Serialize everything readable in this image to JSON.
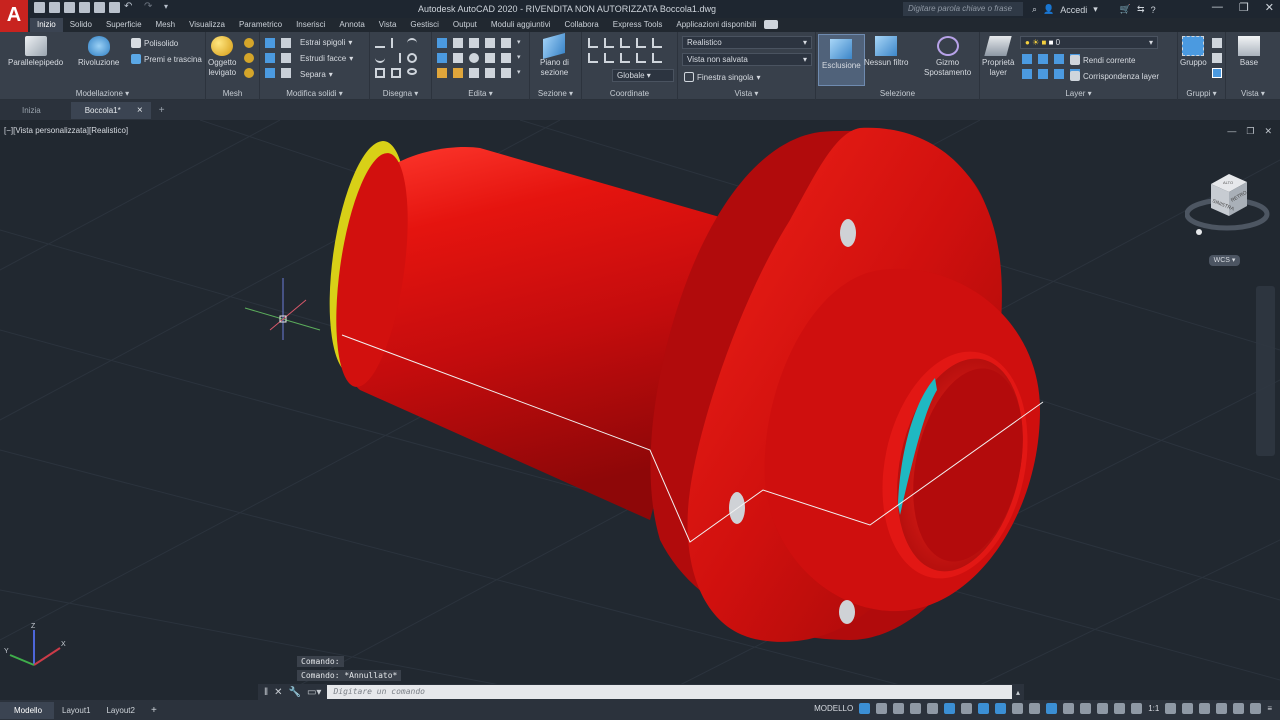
{
  "titlebar": {
    "app_title": "Autodesk AutoCAD 2020 - RIVENDITA NON AUTORIZZATA    Boccola1.dwg",
    "search_placeholder": "Digitare parola chiave o frase",
    "signin_label": "Accedi",
    "logo_letter": "A"
  },
  "ribbon_tabs": [
    "Inizio",
    "Solido",
    "Superficie",
    "Mesh",
    "Visualizza",
    "Parametrico",
    "Inserisci",
    "Annota",
    "Vista",
    "Gestisci",
    "Output",
    "Moduli aggiuntivi",
    "Collabora",
    "Express Tools",
    "Applicazioni disponibili"
  ],
  "ribbon": {
    "modellazione": {
      "title": "Modellazione",
      "parallelepipedo": "Parallelepipedo",
      "rivoluzione": "Rivoluzione",
      "polisolido": "Polisolido",
      "premi": "Premi e trascina"
    },
    "mesh": {
      "title": "Mesh",
      "oggetto": "Oggetto",
      "levigato": "levigato"
    },
    "modifica": {
      "title": "Modifica solidi",
      "estrai": "Estrai spigoli",
      "estrudi": "Estrudi facce",
      "separa": "Separa"
    },
    "disegna": {
      "title": "Disegna"
    },
    "edita": {
      "title": "Edita"
    },
    "sezione": {
      "title": "Sezione",
      "piano": "Piano di",
      "sezione_lbl": "sezione"
    },
    "coordinate": {
      "title": "Coordinate",
      "globale": "Globale"
    },
    "vista": {
      "title": "Vista",
      "style": "Realistico",
      "saved": "Vista non salvata",
      "finestra": "Finestra singola"
    },
    "selezione": {
      "title": "Selezione",
      "esclusione": "Esclusione",
      "nessun": "Nessun filtro",
      "gizmo": "Gizmo",
      "spostamento": "Spostamento"
    },
    "layer": {
      "title": "Layer",
      "proprieta": "Proprietà",
      "layer_lbl": "layer",
      "current_layer": "0",
      "rendi": "Rendi corrente",
      "corrispondenza": "Corrispondenza layer"
    },
    "gruppi": {
      "title": "Gruppi",
      "gruppo": "Gruppo"
    },
    "vista2": {
      "title": "Vista",
      "base": "Base"
    }
  },
  "doc_tabs": {
    "inizio": "Inizia",
    "file": "Boccola1*",
    "close": "×",
    "add": "+"
  },
  "viewport": {
    "label": "[−][Vista personalizzata][Realistico]",
    "viewcube_face": "SINISTRA",
    "viewcube_side": "RETRO",
    "viewcube_top": "ALTO",
    "wcs": "WCS",
    "ucs_x": "X",
    "ucs_y": "Y",
    "ucs_z": "Z"
  },
  "command": {
    "history": [
      "Comando:",
      "Comando: *Annullato*"
    ],
    "placeholder": "Digitare un comando"
  },
  "status": {
    "tabs": [
      "Modello",
      "Layout1",
      "Layout2"
    ],
    "add": "+",
    "mode": "MODELLO",
    "scale": "1:1"
  },
  "colors": {
    "part": "#cc0f10",
    "yellow_face": "#d8d017",
    "cyan_face": "#1fb8c2",
    "background": "#212830"
  }
}
